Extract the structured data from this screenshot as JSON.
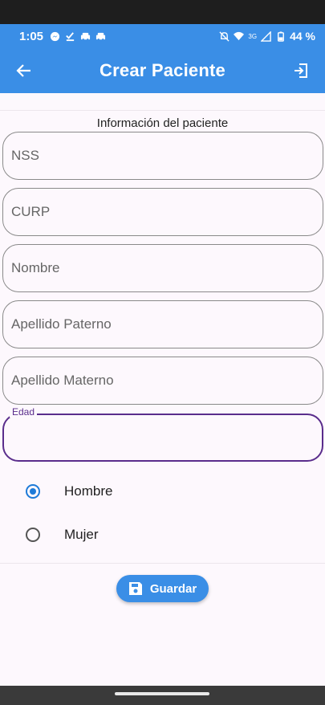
{
  "status_bar": {
    "time": "1:05",
    "network": "3G",
    "battery": "44 %"
  },
  "app_bar": {
    "title": "Crear Paciente",
    "back_icon": "arrow-left-icon",
    "exit_icon": "exit-icon"
  },
  "form": {
    "section_title": "Información del paciente",
    "fields": [
      {
        "label": "NSS",
        "value": ""
      },
      {
        "label": "CURP",
        "value": ""
      },
      {
        "label": "Nombre",
        "value": ""
      },
      {
        "label": "Apellido Paterno",
        "value": ""
      },
      {
        "label": "Apellido Materno",
        "value": ""
      },
      {
        "label": "Edad",
        "value": "",
        "focused": true
      }
    ],
    "gender": {
      "options": [
        "Hombre",
        "Mujer"
      ],
      "selected": "Hombre"
    },
    "save_label": "Guardar",
    "save_icon": "floppy-disk-icon"
  },
  "colors": {
    "primary": "#3a8ee6",
    "focus": "#5a2d8c",
    "background": "#fdf8fd",
    "radio_selected": "#1e7bd8"
  }
}
